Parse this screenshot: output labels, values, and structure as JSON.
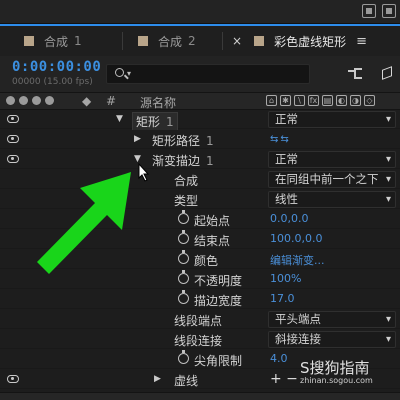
{
  "tabs": [
    {
      "label": "合成",
      "num": "1"
    },
    {
      "label": "合成",
      "num": "2"
    },
    {
      "label": "彩色虚线矩形",
      "active": true
    }
  ],
  "header": {
    "timecode": "0:00:00:00",
    "fps": "00000 (15.00 fps)",
    "search_placeholder": ""
  },
  "columns": {
    "layer_name": "源名称",
    "hash": "#"
  },
  "rows": [
    {
      "name": "矩形",
      "num": "1",
      "value": "正常",
      "value_kind": "dropdown",
      "eye": true
    },
    {
      "name": "矩形路径",
      "num": "1",
      "value": "",
      "value_kind": "path-icon",
      "eye": true
    },
    {
      "name": "渐变描边",
      "num": "1",
      "value": "正常",
      "value_kind": "dropdown",
      "eye": true
    },
    {
      "name": "合成",
      "value": "在同组中前一个之下",
      "value_kind": "dropdown"
    },
    {
      "name": "类型",
      "value": "线性",
      "value_kind": "dropdown"
    },
    {
      "name": "起始点",
      "value": "0.0,0.0",
      "value_kind": "text",
      "stopwatch": true
    },
    {
      "name": "结束点",
      "value": "100.0,0.0",
      "value_kind": "text",
      "stopwatch": true
    },
    {
      "name": "颜色",
      "value": "编辑渐变...",
      "value_kind": "text",
      "stopwatch": true
    },
    {
      "name": "不透明度",
      "value": "100%",
      "value_kind": "text",
      "stopwatch": true
    },
    {
      "name": "描边宽度",
      "value": "17.0",
      "value_kind": "text",
      "stopwatch": true
    },
    {
      "name": "线段端点",
      "value": "平头端点",
      "value_kind": "dropdown"
    },
    {
      "name": "线段连接",
      "value": "斜接连接",
      "value_kind": "dropdown"
    },
    {
      "name": "尖角限制",
      "value": "4.0",
      "value_kind": "text",
      "stopwatch": true
    },
    {
      "name": "虚线",
      "value": "+ −",
      "value_kind": "plusminus",
      "eye": true
    }
  ],
  "watermark": {
    "text": "S搜狗指南",
    "url": "zhinan.sogou.com"
  },
  "colors": {
    "accent": "#3b8fe0",
    "value_blue": "#4a8fd8",
    "arrow_green": "#19d51a"
  }
}
